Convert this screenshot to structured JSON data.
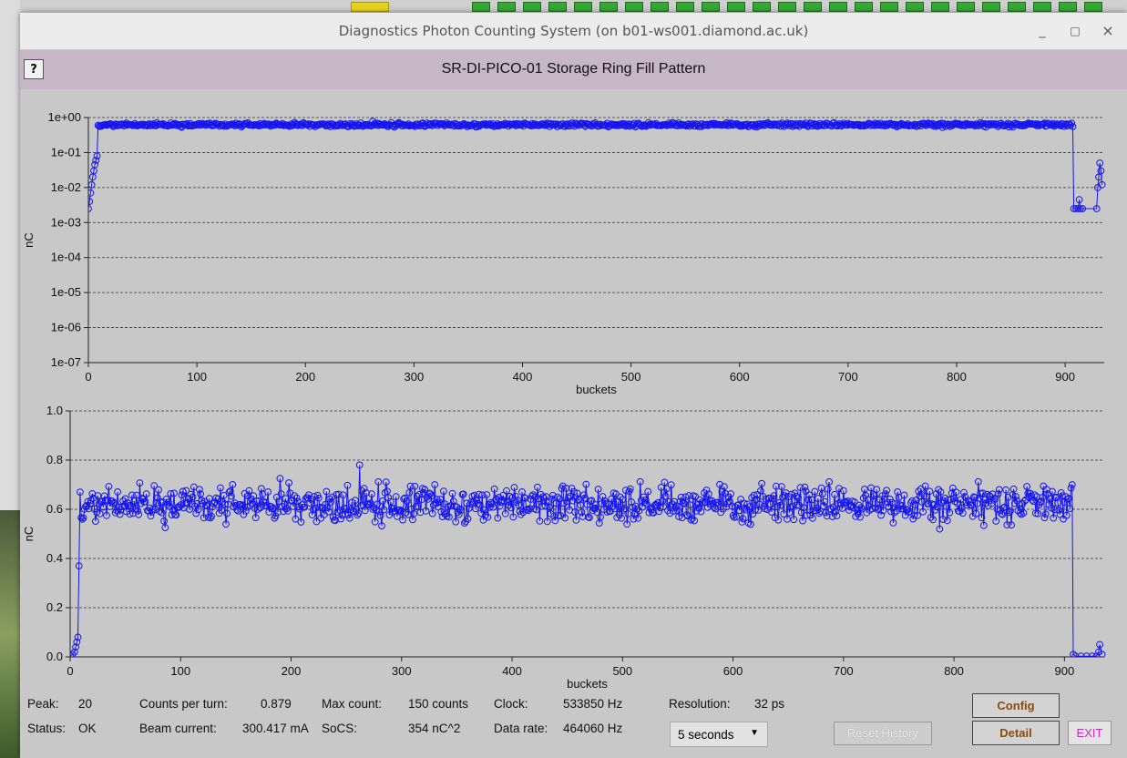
{
  "window": {
    "title": "Diagnostics Photon Counting System  (on b01-ws001.diamond.ac.uk)",
    "controls": [
      "_",
      "□",
      "×"
    ]
  },
  "header": {
    "help_label": "?",
    "title": "SR-DI-PICO-01 Storage Ring Fill Pattern"
  },
  "chart_data": [
    {
      "type": "line",
      "scale": "log",
      "xlabel": "buckets",
      "ylabel": "nC",
      "xlim": [
        0,
        936
      ],
      "ylim": [
        1e-07,
        1
      ],
      "xticks": [
        "0",
        "100",
        "200",
        "300",
        "400",
        "500",
        "600",
        "700",
        "800",
        "900"
      ],
      "yticks": [
        "1e+00",
        "1e-01",
        "1e-02",
        "1e-03",
        "1e-04",
        "1e-05",
        "1e-06",
        "1e-07"
      ],
      "grid": true,
      "series": [
        {
          "color": "#1515f0",
          "marker": "circle",
          "ramp_start": [
            [
              0,
              0.0025
            ],
            [
              1,
              0.004
            ],
            [
              2,
              0.007
            ],
            [
              3,
              0.012
            ],
            [
              4,
              0.02
            ],
            [
              5,
              0.03
            ],
            [
              6,
              0.045
            ],
            [
              7,
              0.06
            ],
            [
              8,
              0.08
            ],
            [
              9,
              0.6
            ]
          ],
          "fill_range": [
            9,
            906
          ],
          "fill_level_nC": 0.62,
          "fill_spread_nC": 0.07,
          "gap_points": [
            [
              907,
              0.55
            ],
            [
              908,
              0.0025
            ],
            [
              910,
              0.0025
            ],
            [
              912,
              0.0025
            ],
            [
              913,
              0.0045
            ],
            [
              914,
              0.0025
            ],
            [
              916,
              0.0025
            ],
            [
              929,
              0.0025
            ],
            [
              930,
              0.01
            ],
            [
              931,
              0.02
            ],
            [
              932,
              0.05
            ],
            [
              933,
              0.03
            ],
            [
              934,
              0.012
            ]
          ]
        }
      ]
    },
    {
      "type": "line",
      "scale": "linear",
      "xlabel": "buckets",
      "ylabel": "nC",
      "xlim": [
        0,
        936
      ],
      "ylim": [
        0,
        1
      ],
      "xticks": [
        "0",
        "100",
        "200",
        "300",
        "400",
        "500",
        "600",
        "700",
        "800",
        "900"
      ],
      "yticks": [
        "1.0",
        "0.8",
        "0.6",
        "0.4",
        "0.2",
        "0.0"
      ],
      "grid": true,
      "series": [
        {
          "color": "#1515f0",
          "marker": "circle",
          "ramp_start": [
            [
              0,
              0.003
            ],
            [
              2,
              0.01
            ],
            [
              4,
              0.02
            ],
            [
              5,
              0.04
            ],
            [
              6,
              0.06
            ],
            [
              7,
              0.08
            ],
            [
              8,
              0.37
            ],
            [
              9,
              0.67
            ]
          ],
          "fill_range": [
            9,
            906
          ],
          "fill_level_nC": 0.62,
          "fill_spread_nC": 0.07,
          "gap_points": [
            [
              907,
              0.7
            ],
            [
              908,
              0.01
            ],
            [
              910,
              0.003
            ],
            [
              915,
              0.003
            ],
            [
              920,
              0.003
            ],
            [
              925,
              0.003
            ],
            [
              929,
              0.003
            ],
            [
              931,
              0.02
            ],
            [
              932,
              0.05
            ],
            [
              934,
              0.01
            ]
          ]
        }
      ]
    }
  ],
  "status": {
    "peak_label": "Peak:",
    "peak_value": "20",
    "status_label": "Status:",
    "status_value": "OK",
    "counts_label": "Counts per turn:",
    "counts_value": "0.879",
    "beam_label": "Beam current:",
    "beam_value": "300.417 mA",
    "maxcount_label": "Max count:",
    "maxcount_value": "150 counts",
    "socs_label": "SoCS:",
    "socs_value": "354 nC^2",
    "clock_label": "Clock:",
    "clock_value": "533850 Hz",
    "datarate_label": "Data rate:",
    "datarate_value": "464060 Hz",
    "resolution_label": "Resolution:",
    "resolution_value": "32 ps"
  },
  "controls": {
    "history_select": "5 seconds",
    "reset_label": "Reset History",
    "config_label": "Config",
    "detail_label": "Detail",
    "exit_label": "EXIT"
  }
}
